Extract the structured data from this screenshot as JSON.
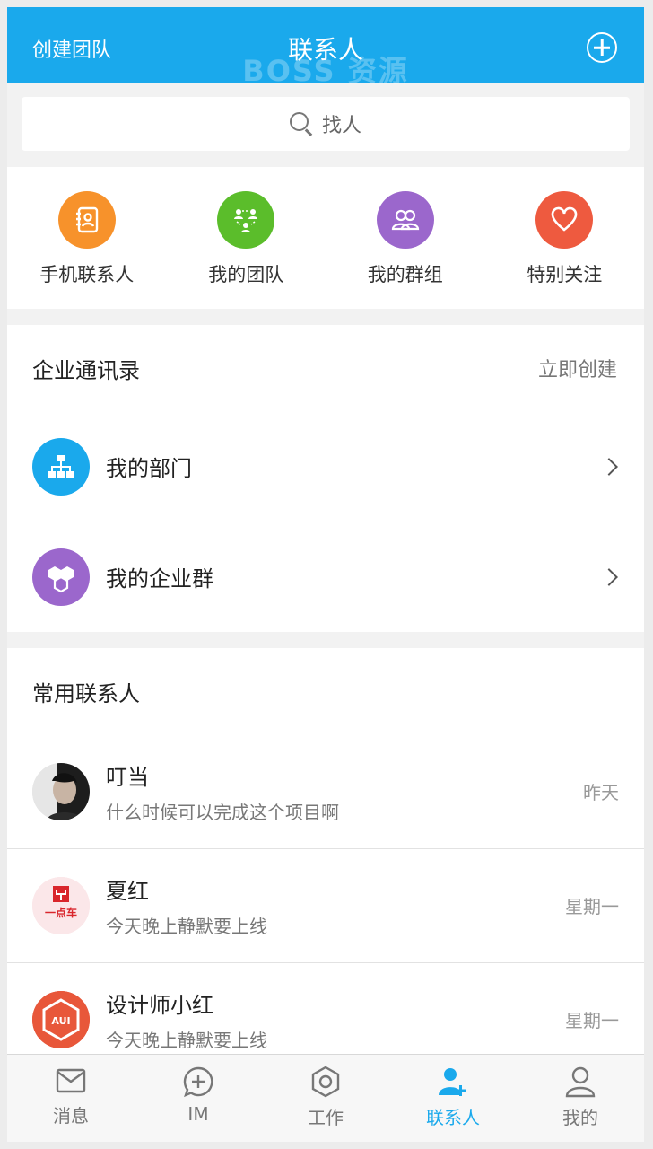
{
  "header": {
    "left_label": "创建团队",
    "title": "联系人",
    "watermark": "BOSS 资源"
  },
  "search": {
    "placeholder": "找人"
  },
  "quick_links": [
    {
      "label": "手机联系人",
      "icon": "address-book-icon",
      "color": "#f7922b"
    },
    {
      "label": "我的团队",
      "icon": "team-icon",
      "color": "#5bbd2b"
    },
    {
      "label": "我的群组",
      "icon": "group-icon",
      "color": "#9b67cc"
    },
    {
      "label": "特别关注",
      "icon": "heart-icon",
      "color": "#ee5a3f"
    }
  ],
  "enterprise": {
    "title": "企业通讯录",
    "action": "立即创建",
    "items": [
      {
        "label": "我的部门",
        "icon": "org-chart-icon",
        "color": "#1aa9ec"
      },
      {
        "label": "我的企业群",
        "icon": "hexagons-icon",
        "color": "#9b67cc"
      }
    ]
  },
  "frequent": {
    "title": "常用联系人",
    "contacts": [
      {
        "name": "叮当",
        "message": "什么时候可以完成这个项目啊",
        "time": "昨天"
      },
      {
        "name": "夏红",
        "message": "今天晚上静默要上线",
        "time": "星期一",
        "avatar_text": "一点车"
      },
      {
        "name": "设计师小红",
        "message": "今天晚上静默要上线",
        "time": "星期一",
        "avatar_text": "AUI"
      }
    ]
  },
  "tabbar": {
    "tabs": [
      {
        "label": "消息",
        "icon": "envelope-icon"
      },
      {
        "label": "IM",
        "icon": "chat-plus-icon"
      },
      {
        "label": "工作",
        "icon": "hexagon-gear-icon"
      },
      {
        "label": "联系人",
        "icon": "contact-add-icon",
        "active": true
      },
      {
        "label": "我的",
        "icon": "user-icon"
      }
    ],
    "active_color": "#1aa9ec"
  }
}
